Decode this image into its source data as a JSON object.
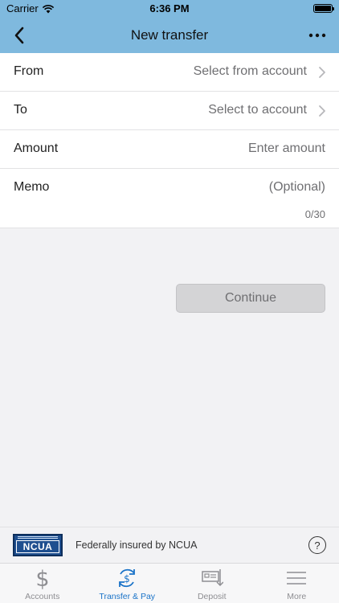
{
  "status_bar": {
    "carrier": "Carrier",
    "time": "6:36 PM"
  },
  "nav": {
    "title": "New transfer"
  },
  "form": {
    "from": {
      "label": "From",
      "value": "Select from account"
    },
    "to": {
      "label": "To",
      "value": "Select to account"
    },
    "amount": {
      "label": "Amount",
      "placeholder": "Enter amount"
    },
    "memo": {
      "label": "Memo",
      "placeholder": "(Optional)",
      "counter": "0/30"
    }
  },
  "continue_label": "Continue",
  "ncua": {
    "logo_text": "NCUA",
    "text": "Federally insured by NCUA",
    "help": "?"
  },
  "tabs": [
    {
      "label": "Accounts",
      "icon": "dollar-icon",
      "active": false
    },
    {
      "label": "Transfer & Pay",
      "icon": "transfer-pay-icon",
      "active": true
    },
    {
      "label": "Deposit",
      "icon": "deposit-check-icon",
      "active": false
    },
    {
      "label": "More",
      "icon": "menu-icon",
      "active": false
    }
  ],
  "colors": {
    "header": "#7fb9de",
    "accent": "#1a73c8",
    "disabled_button": "#d4d4d6"
  }
}
